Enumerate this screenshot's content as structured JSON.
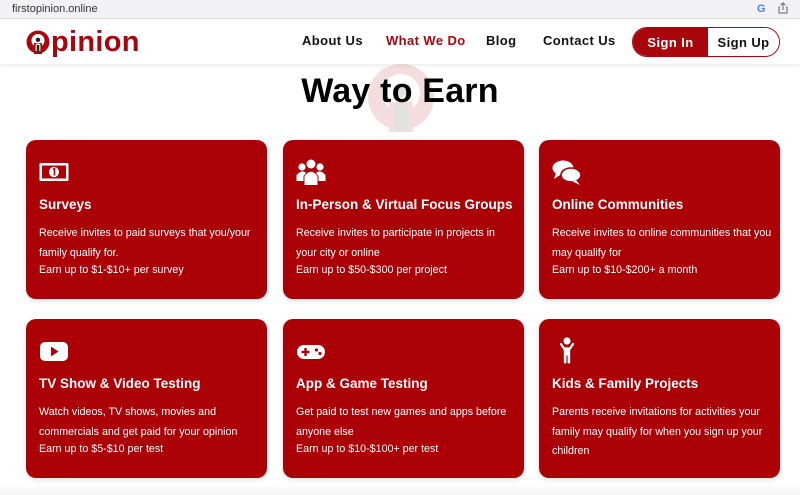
{
  "browser": {
    "url": "firstopinion.online"
  },
  "header": {
    "logo_text": "pinion",
    "nav": [
      "About Us",
      "What We Do",
      "Blog",
      "Contact Us"
    ],
    "signin_label": "Sign In",
    "signup_label": "Sign Up"
  },
  "main": {
    "title": "Way to Earn",
    "cards": [
      {
        "icon": "money-icon",
        "title": "Surveys",
        "desc": "Receive invites to paid surveys that you/your family qualify for.",
        "earn": "Earn up to $1-$10+ per survey"
      },
      {
        "icon": "group-icon",
        "title": "In-Person & Virtual Focus Groups",
        "desc": "Receive invites to participate in projects in your city or online",
        "earn": "Earn up to $50-$300 per project"
      },
      {
        "icon": "chat-icon",
        "title": "Online Communities",
        "desc": "Receive invites to online communities that you may qualify for",
        "earn": "Earn up to $10-$200+ a month"
      },
      {
        "icon": "video-play-icon",
        "title": "TV Show & Video Testing",
        "desc": "Watch videos, TV shows, movies and commercials and get paid for your opinion",
        "earn": "Earn up to $5-$10 per test"
      },
      {
        "icon": "gamepad-icon",
        "title": "App & Game Testing",
        "desc": "Get paid to test new games and apps before anyone else",
        "earn": "Earn up to $10-$100+ per test"
      },
      {
        "icon": "child-icon",
        "title": "Kids & Family Projects",
        "desc": "Parents receive invitations for activities your family may qualify for when you sign up your children",
        "earn": ""
      }
    ]
  },
  "colors": {
    "brand": "#a8060c",
    "card": "#ab0006"
  }
}
